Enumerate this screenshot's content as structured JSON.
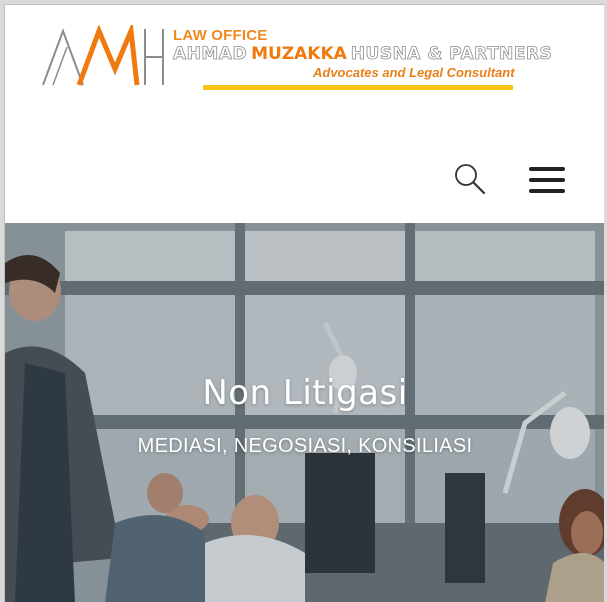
{
  "header": {
    "logo": {
      "monogram": "AMH",
      "line1": "LAW OFFICE",
      "name_first": "AHMAD",
      "name_bold": "MUZAKKA",
      "name_rest": "HUSNA & PARTNERS",
      "tagline": "Advocates and Legal Consultant"
    },
    "search_icon": "search-icon",
    "menu_icon": "hamburger-menu-icon"
  },
  "hero": {
    "title": "Non Litigasi",
    "subtitle": "MEDIASI, NEGOSIASI, KONSILIASI"
  },
  "colors": {
    "brand_orange": "#f07a0f",
    "brand_yellow": "#f5c416",
    "logo_gray": "#8c8c8c",
    "hero_text": "#ffffff"
  }
}
